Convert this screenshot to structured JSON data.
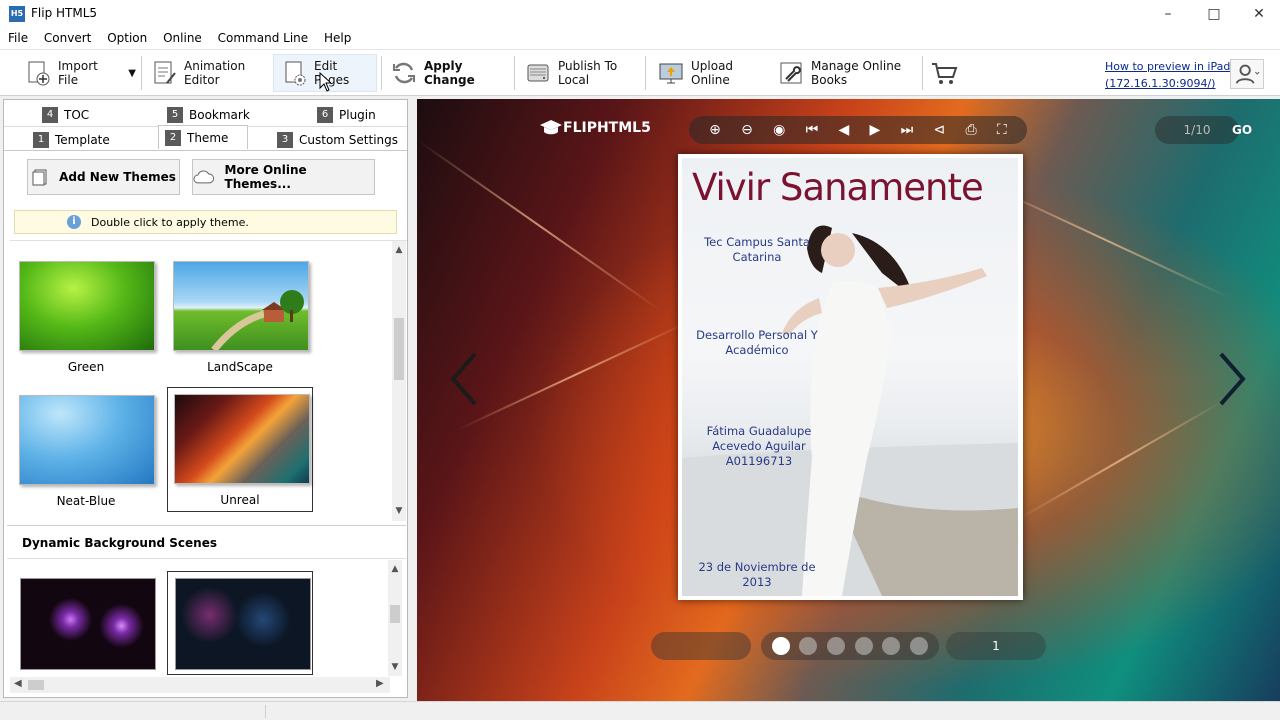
{
  "window": {
    "title": "Flip HTML5",
    "icon_label": "H5"
  },
  "menu": [
    "File",
    "Convert",
    "Option",
    "Online",
    "Command Line",
    "Help"
  ],
  "toolbar": {
    "import_file": "Import File",
    "animation_editor": "Animation Editor",
    "edit_pages": "Edit Pages",
    "apply_change": "Apply Change",
    "publish_to_local": "Publish To Local",
    "upload_online": "Upload Online",
    "manage_online_books": "Manage Online Books",
    "help_link_line1": "How to preview in iPad",
    "help_link_line2": "(172.16.1.30:9094/)"
  },
  "tabs": {
    "toc": {
      "num": "4",
      "label": "TOC"
    },
    "bookmark": {
      "num": "5",
      "label": "Bookmark"
    },
    "plugin": {
      "num": "6",
      "label": "Plugin"
    },
    "template": {
      "num": "1",
      "label": "Template"
    },
    "theme": {
      "num": "2",
      "label": "Theme"
    },
    "custom_settings": {
      "num": "3",
      "label": "Custom Settings"
    }
  },
  "theme_panel": {
    "add_new_themes": "Add New Themes",
    "more_online_themes": "More Online Themes...",
    "hint": "Double click to apply theme.",
    "themes": [
      {
        "name": "Green"
      },
      {
        "name": "LandScape"
      },
      {
        "name": "Neat-Blue"
      },
      {
        "name": "Unreal",
        "selected": true
      }
    ],
    "scenes_header": "Dynamic Background Scenes"
  },
  "viewer": {
    "logo": "FLIPHTML5",
    "page_counter": "1/10",
    "go": "GO",
    "current_page": "1",
    "page_dots": 6,
    "active_dot": 0
  },
  "book_cover": {
    "title": "Vivir Sanamente",
    "campus": "Tec Campus Santa Catarina",
    "subject": "Desarrollo Personal Y Académico",
    "author": "Fátima Guadalupe Acevedo Aguilar A01196713",
    "date": "23 de Noviembre de 2013"
  },
  "colors": {
    "title_color": "#7b1230",
    "cover_text_color": "#283a86",
    "link_color": "#0b2a8c"
  }
}
